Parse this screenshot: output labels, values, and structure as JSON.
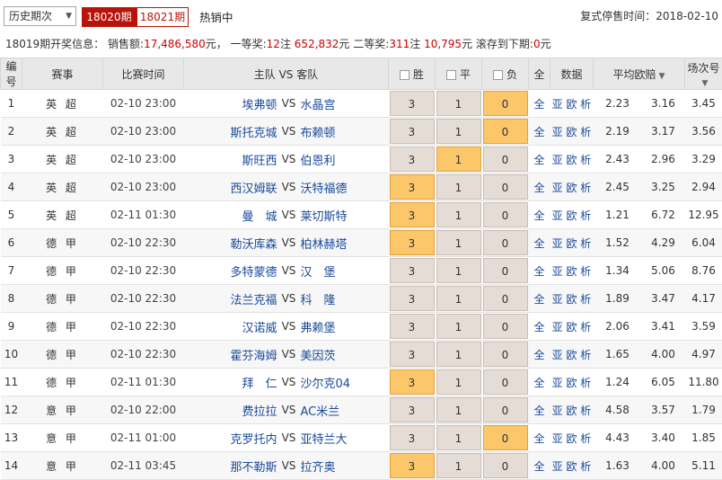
{
  "topbar": {
    "history_select": "历史期次",
    "tabs": [
      "18020期",
      "18021期"
    ],
    "hot": "热销中",
    "stop_label": "复式停售时间：",
    "stop_time": "2018-02-10"
  },
  "info": {
    "issue": "18019期开奖信息：",
    "sales_label": "销售额:",
    "sales": "17,486,580",
    "yuan1": "元，",
    "first_label": "一等奖:",
    "first_count": "12",
    "zhu1": "注",
    "first_amount": "652,832",
    "yuan2": "元",
    "second_label": "二等奖:",
    "second_count": "311",
    "zhu2": "注",
    "second_amount": "10,795",
    "yuan3": "元",
    "roll_label": "滚存到下期:",
    "roll": "0",
    "yuan4": "元"
  },
  "headers": {
    "no": "编号",
    "league": "赛事",
    "time": "比赛时间",
    "teams": "主队 VS 客队",
    "win": "胜",
    "draw": "平",
    "lose": "负",
    "all": "全",
    "data": "数据",
    "avg": "平均欧赔",
    "order": "场次号"
  },
  "rows": [
    {
      "no": "1",
      "league": "英 超",
      "time": "02-10 23:00",
      "home": "埃弗顿",
      "vs": "VS",
      "away": "水晶宫",
      "sel": 2,
      "all": "全",
      "links": "亚 欧 析",
      "o1": "2.23",
      "o2": "3.16",
      "o3": "3.45"
    },
    {
      "no": "2",
      "league": "英 超",
      "time": "02-10 23:00",
      "home": "斯托克城",
      "vs": "VS",
      "away": "布赖顿",
      "sel": 2,
      "all": "全",
      "links": "亚 欧 析",
      "o1": "2.19",
      "o2": "3.17",
      "o3": "3.56"
    },
    {
      "no": "3",
      "league": "英 超",
      "time": "02-10 23:00",
      "home": "斯旺西",
      "vs": "VS",
      "away": "伯恩利",
      "sel": 1,
      "all": "全",
      "links": "亚 欧 析",
      "o1": "2.43",
      "o2": "2.96",
      "o3": "3.29"
    },
    {
      "no": "4",
      "league": "英 超",
      "time": "02-10 23:00",
      "home": "西汉姆联",
      "vs": "VS",
      "away": "沃特福德",
      "sel": 0,
      "all": "全",
      "links": "亚 欧 析",
      "o1": "2.45",
      "o2": "3.25",
      "o3": "2.94"
    },
    {
      "no": "5",
      "league": "英 超",
      "time": "02-11 01:30",
      "home": "曼　城",
      "vs": "VS",
      "away": "莱切斯特",
      "sel": 0,
      "all": "全",
      "links": "亚 欧 析",
      "o1": "1.21",
      "o2": "6.72",
      "o3": "12.95"
    },
    {
      "no": "6",
      "league": "德 甲",
      "time": "02-10 22:30",
      "home": "勒沃库森",
      "vs": "VS",
      "away": "柏林赫塔",
      "sel": 0,
      "all": "全",
      "links": "亚 欧 析",
      "o1": "1.52",
      "o2": "4.29",
      "o3": "6.04"
    },
    {
      "no": "7",
      "league": "德 甲",
      "time": "02-10 22:30",
      "home": "多特蒙德",
      "vs": "VS",
      "away": "汉　堡",
      "sel": -1,
      "all": "全",
      "links": "亚 欧 析",
      "o1": "1.34",
      "o2": "5.06",
      "o3": "8.76"
    },
    {
      "no": "8",
      "league": "德 甲",
      "time": "02-10 22:30",
      "home": "法兰克福",
      "vs": "VS",
      "away": "科　隆",
      "sel": -1,
      "all": "全",
      "links": "亚 欧 析",
      "o1": "1.89",
      "o2": "3.47",
      "o3": "4.17"
    },
    {
      "no": "9",
      "league": "德 甲",
      "time": "02-10 22:30",
      "home": "汉诺威",
      "vs": "VS",
      "away": "弗赖堡",
      "sel": -1,
      "all": "全",
      "links": "亚 欧 析",
      "o1": "2.06",
      "o2": "3.41",
      "o3": "3.59"
    },
    {
      "no": "10",
      "league": "德 甲",
      "time": "02-10 22:30",
      "home": "霍芬海姆",
      "vs": "VS",
      "away": "美因茨",
      "sel": -1,
      "all": "全",
      "links": "亚 欧 析",
      "o1": "1.65",
      "o2": "4.00",
      "o3": "4.97"
    },
    {
      "no": "11",
      "league": "德 甲",
      "time": "02-11 01:30",
      "home": "拜　仁",
      "vs": "VS",
      "away": "沙尔克04",
      "sel": 0,
      "all": "全",
      "links": "亚 欧 析",
      "o1": "1.24",
      "o2": "6.05",
      "o3": "11.80"
    },
    {
      "no": "12",
      "league": "意 甲",
      "time": "02-10 22:00",
      "home": "费拉拉",
      "vs": "VS",
      "away": "AC米兰",
      "sel": -1,
      "all": "全",
      "links": "亚 欧 析",
      "o1": "4.58",
      "o2": "3.57",
      "o3": "1.79"
    },
    {
      "no": "13",
      "league": "意 甲",
      "time": "02-11 01:00",
      "home": "克罗托内",
      "vs": "VS",
      "away": "亚特兰大",
      "sel": 2,
      "all": "全",
      "links": "亚 欧 析",
      "o1": "4.43",
      "o2": "3.40",
      "o3": "1.85"
    },
    {
      "no": "14",
      "league": "意 甲",
      "time": "02-11 03:45",
      "home": "那不勒斯",
      "vs": "VS",
      "away": "拉齐奥",
      "sel": 0,
      "all": "全",
      "links": "亚 欧 析",
      "o1": "1.63",
      "o2": "4.00",
      "o3": "5.11"
    }
  ],
  "odds_values": [
    "3",
    "1",
    "0"
  ]
}
